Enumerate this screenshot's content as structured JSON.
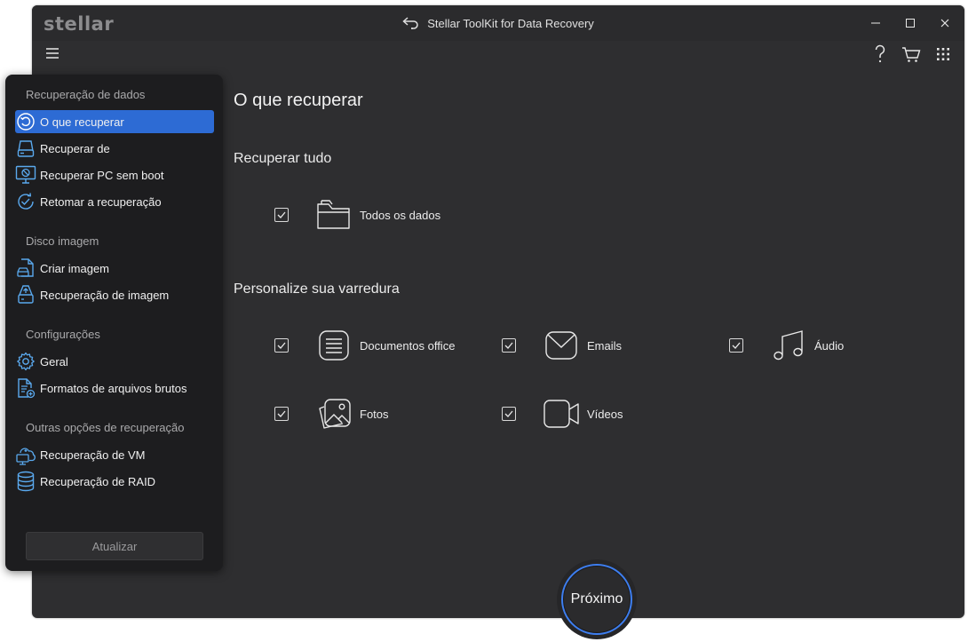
{
  "app": {
    "logo_text": "stellar",
    "title": "Stellar ToolKit for Data Recovery"
  },
  "icons": {
    "window_controls": [
      "minimize-icon",
      "maximize-icon",
      "close-icon"
    ],
    "toolbar": [
      "menu-icon",
      "help-icon",
      "cart-icon",
      "apps-grid-icon"
    ]
  },
  "colors": {
    "accent": "#2d6bd4",
    "next_ring": "#3d7ef0",
    "sidebar_icon": "#5aa9ee",
    "window_bg": "#2e2e30",
    "sidebar_bg": "#1d1d1f"
  },
  "sidebar": {
    "sections": [
      {
        "title": "Recuperação de dados",
        "items": [
          {
            "label": "O que recuperar",
            "icon": "restore-icon",
            "active": true
          },
          {
            "label": "Recuperar de",
            "icon": "drive-icon",
            "active": false
          },
          {
            "label": "Recuperar PC sem boot",
            "icon": "no-boot-pc-icon",
            "active": false
          },
          {
            "label": "Retomar a recuperação",
            "icon": "resume-icon",
            "active": false
          }
        ]
      },
      {
        "title": "Disco imagem",
        "items": [
          {
            "label": "Criar imagem",
            "icon": "create-image-icon",
            "active": false
          },
          {
            "label": "Recuperação de imagem",
            "icon": "image-recovery-icon",
            "active": false
          }
        ]
      },
      {
        "title": "Configurações",
        "items": [
          {
            "label": "Geral",
            "icon": "gear-icon",
            "active": false
          },
          {
            "label": "Formatos de arquivos brutos",
            "icon": "raw-formats-icon",
            "active": false
          }
        ]
      },
      {
        "title": "Outras opções de recuperação",
        "items": [
          {
            "label": "Recuperação de VM",
            "icon": "vm-icon",
            "active": false
          },
          {
            "label": "Recuperação de RAID",
            "icon": "raid-icon",
            "active": false
          }
        ]
      }
    ],
    "update_button": "Atualizar"
  },
  "main": {
    "heading": "O que recuperar",
    "recover_all": {
      "title": "Recuperar tudo",
      "option": {
        "label": "Todos os dados",
        "checked": true,
        "icon": "folder-icon"
      }
    },
    "custom": {
      "title": "Personalize sua varredura",
      "options": [
        {
          "label": "Documentos office",
          "checked": true,
          "icon": "document-icon"
        },
        {
          "label": "Emails",
          "checked": true,
          "icon": "email-icon"
        },
        {
          "label": "Áudio",
          "checked": true,
          "icon": "music-icon"
        },
        {
          "label": "Fotos",
          "checked": true,
          "icon": "photos-icon"
        },
        {
          "label": "Vídeos",
          "checked": true,
          "icon": "video-icon"
        }
      ]
    },
    "next_button": "Próximo"
  }
}
